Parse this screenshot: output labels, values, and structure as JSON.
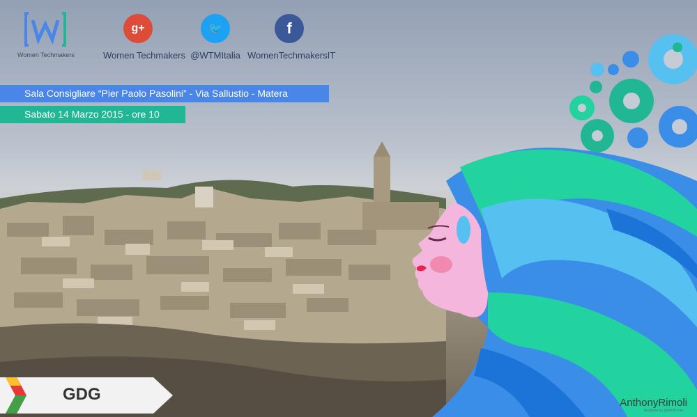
{
  "header": {
    "logo_label": "Women Techmakers",
    "social": [
      {
        "icon": "google-plus-icon",
        "glyph": "g+",
        "color": "#dd4b39",
        "label": "Women Techmakers"
      },
      {
        "icon": "twitter-icon",
        "glyph": "🐦",
        "color": "#1da1f2",
        "label": "@WTMItalia"
      },
      {
        "icon": "facebook-icon",
        "glyph": "f",
        "color": "#3b5998",
        "label": "WomenTechmakersIT"
      }
    ]
  },
  "event": {
    "venue": "Sala Consigliare “Pier Paolo Pasolini” - Via Sallustio - Matera",
    "date": "Sabato 14 Marzo 2015 - ore 10"
  },
  "footer": {
    "gdg_label": "GDG",
    "credit": "AnthonyRimoli",
    "credit_sub": "designed by @rimoli.com"
  },
  "colors": {
    "banner_blue": "#4a85e8",
    "banner_green": "#21b795",
    "gear_blue": "#4a85e8",
    "gear_teal": "#21b795",
    "hair_blue": "#3b8ee8",
    "hair_green": "#22d3a0",
    "face": "#f4b6dc"
  }
}
